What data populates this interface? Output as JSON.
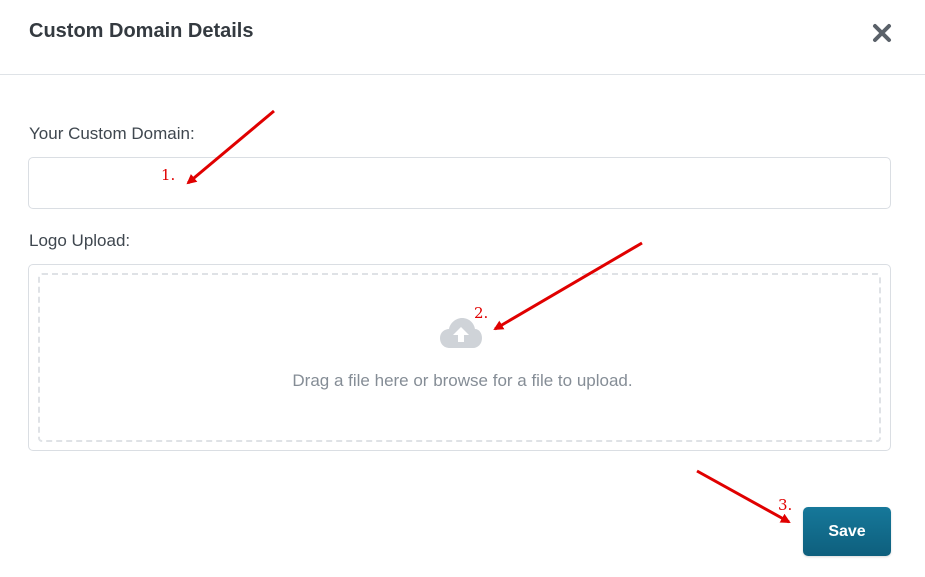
{
  "dialog": {
    "title": "Custom Domain Details",
    "close_icon": "close-icon"
  },
  "form": {
    "domain_label": "Your Custom Domain:",
    "domain_value": "",
    "logo_label": "Logo Upload:",
    "upload_icon": "cloud-upload-icon",
    "dropzone_text": "Drag a file here or browse for a file to upload."
  },
  "actions": {
    "save_label": "Save"
  },
  "annotations": {
    "step1": "1.",
    "step2": "2.",
    "step3": "3.",
    "arrow_color": "#e00000"
  },
  "colors": {
    "primary_button": "#0e6a8a",
    "title_text": "#343a40"
  }
}
